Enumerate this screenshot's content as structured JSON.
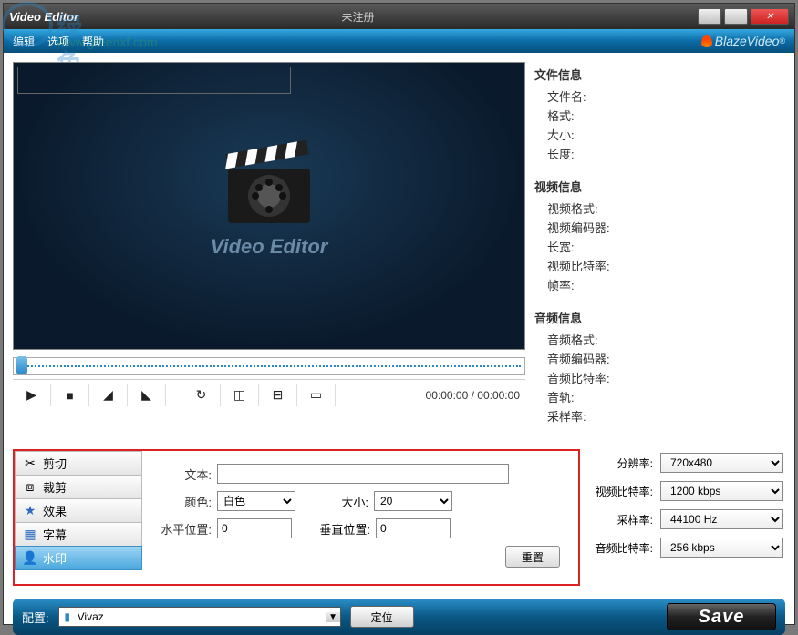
{
  "titlebar": {
    "title": "Video Editor",
    "reg_status": "未注册"
  },
  "menu": {
    "edit": "编辑",
    "options": "选项",
    "help": "帮助"
  },
  "brand": "BlazeVideo",
  "preview": {
    "label": "Video Editor"
  },
  "time": {
    "current": "00:00:00",
    "total": "00:00:00"
  },
  "info": {
    "file": {
      "title": "文件信息",
      "name": "文件名:",
      "format": "格式:",
      "size": "大小:",
      "length": "长度:"
    },
    "video": {
      "title": "视频信息",
      "format": "视频格式:",
      "encoder": "视频编码器:",
      "dimension": "长宽:",
      "bitrate": "视频比特率:",
      "fps": "帧率:"
    },
    "audio": {
      "title": "音频信息",
      "format": "音频格式:",
      "encoder": "音频编码器:",
      "bitrate": "音频比特率:",
      "track": "音轨:",
      "sample": "采样率:"
    }
  },
  "tabs": {
    "cut": "剪切",
    "crop": "裁剪",
    "effect": "效果",
    "subtitle": "字幕",
    "watermark": "水印"
  },
  "form": {
    "text_label": "文本:",
    "text_value": "",
    "color_label": "颜色:",
    "color_value": "白色",
    "size_label": "大小:",
    "size_value": "20",
    "hpos_label": "水平位置:",
    "hpos_value": "0",
    "vpos_label": "垂直位置:",
    "vpos_value": "0",
    "reset": "重置"
  },
  "settings": {
    "resolution_label": "分辨率:",
    "resolution_value": "720x480",
    "vbitrate_label": "视频比特率:",
    "vbitrate_value": "1200 kbps",
    "sample_label": "采样率:",
    "sample_value": "44100 Hz",
    "abitrate_label": "音频比特率:",
    "abitrate_value": "256 kbps"
  },
  "bottom": {
    "profile_label": "配置:",
    "profile_value": "Vivaz",
    "locate": "定位",
    "save": "Save"
  },
  "overlay": {
    "text": "绿色先锋",
    "url": "www.greenxf.com"
  }
}
